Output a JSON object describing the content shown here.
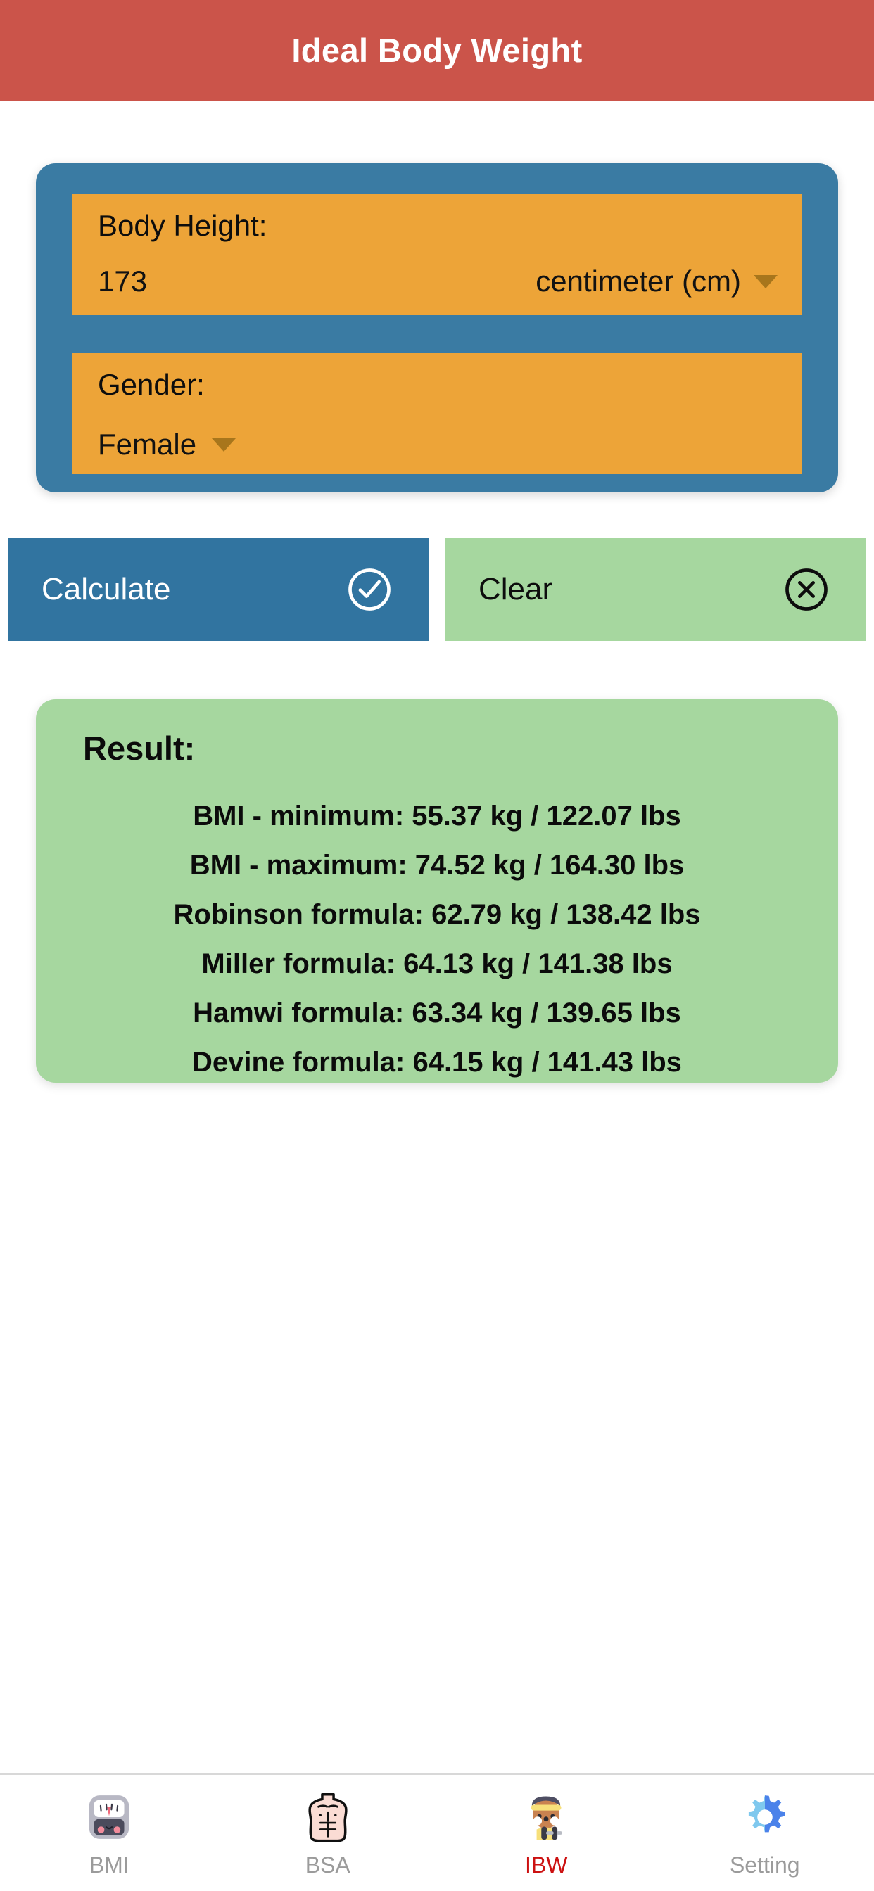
{
  "app": {
    "title": "Ideal Body Weight",
    "header_color": "#cb544a",
    "card_color": "#3a7ba3",
    "field_color": "#eda438",
    "result_color": "#a6d79f"
  },
  "form": {
    "height": {
      "label": "Body Height:",
      "value": "173",
      "unit": "centimeter (cm)",
      "caret_icon": "chevron-down-icon"
    },
    "gender": {
      "label": "Gender:",
      "value": "Female",
      "caret_icon": "chevron-down-icon"
    }
  },
  "actions": {
    "calculate": {
      "label": "Calculate",
      "icon": "check-circle-icon",
      "color": "#3174a0"
    },
    "clear": {
      "label": "Clear",
      "icon": "x-circle-icon",
      "color": "#a6d79f"
    }
  },
  "result": {
    "title": "Result:",
    "lines": [
      "BMI - minimum: 55.37 kg / 122.07 lbs",
      "BMI - maximum: 74.52 kg / 164.30 lbs",
      "Robinson formula: 62.79 kg / 138.42 lbs",
      "Miller formula: 64.13 kg / 141.38 lbs",
      "Hamwi formula: 63.34 kg / 139.65 lbs",
      "Devine formula: 64.15 kg / 141.43 lbs"
    ]
  },
  "bottom_nav": {
    "active_color": "#cc1111",
    "inactive_color": "#9b9b9b",
    "items": [
      {
        "label": "BMI",
        "icon": "bathroom-scale-icon",
        "active": false
      },
      {
        "label": "BSA",
        "icon": "torso-body-icon",
        "active": false
      },
      {
        "label": "IBW",
        "icon": "weight-lifter-icon",
        "active": true
      },
      {
        "label": "Setting",
        "icon": "gear-icon",
        "active": false
      }
    ]
  }
}
